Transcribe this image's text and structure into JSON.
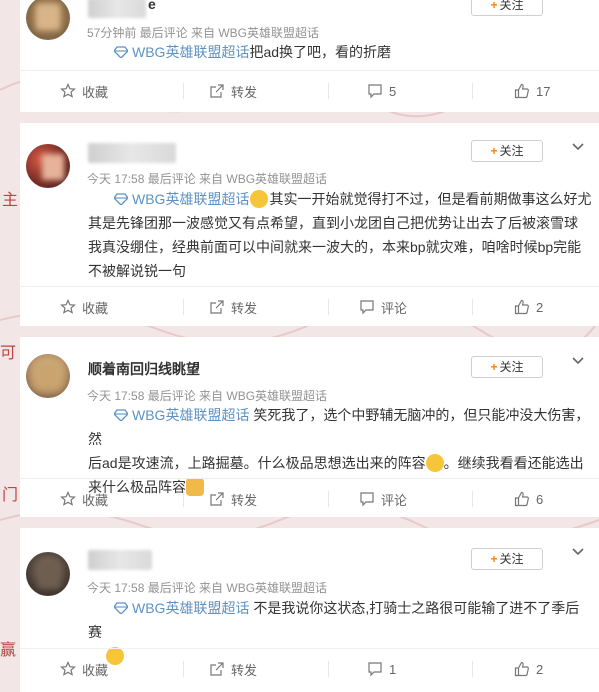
{
  "colors": {
    "topic": "#5e92c2",
    "follow_plus": "#ff8200",
    "meta": "#939393",
    "background": "#f3e6e6"
  },
  "posts": [
    {
      "name": "e",
      "meta": "57分钟前  最后评论  来自 WBG英雄联盟超话",
      "follow": "关注",
      "topic": "WBG英雄联盟超话",
      "text": "把ad换了吧，看的折磨",
      "actions": {
        "fav": "收藏",
        "fwd": "转发",
        "cmt": "5",
        "like": "17"
      }
    },
    {
      "name": "",
      "meta": "今天 17:58  最后评论  来自 WBG英雄联盟超话",
      "follow": "关注",
      "topic": "WBG英雄联盟超话",
      "emoji": "laughing-emoji",
      "text_line1": "其实一开始就觉得打不过，但是看前期做事这么好尤",
      "text_line2": "其是先锋团那一波感觉又有点希望，直到小龙团自己把优势让出去了后被滚雪球",
      "text_line3": "我真没绷住，经典前面可以中间就来一波大的，本来bp就灾难，咱啥时候bp完能",
      "text_line4": "不被解说锐一句",
      "actions": {
        "fav": "收藏",
        "fwd": "转发",
        "cmt": "评论",
        "like": "2"
      }
    },
    {
      "name": "顺着南回归线眺望",
      "meta": "今天 17:58  最后评论  来自 WBG英雄联盟超话",
      "follow": "关注",
      "topic": "WBG英雄联盟超话",
      "text_line1": " 笑死我了，选个中野辅无脑冲的，但只能冲没大伤害，然",
      "text_line2a": "后ad是攻速流，上路掘墓。什么极品思想选出来的阵容",
      "text_line2b": "。继续我看看还能选出",
      "text_line3": "来什么极品阵容",
      "emoji1": "grin-emoji",
      "emoji2": "thumbs-up-emoji",
      "actions": {
        "fav": "收藏",
        "fwd": "转发",
        "cmt": "评论",
        "like": "6"
      }
    },
    {
      "name": "",
      "meta": "今天 17:58  最后评论  来自 WBG英雄联盟超话",
      "follow": "关注",
      "topic": "WBG英雄联盟超话",
      "text": " 不是我说你这状态,打骑士之路很可能输了进不了季后赛",
      "emoji": "shushing-face-emoji",
      "actions": {
        "fav": "收藏",
        "fwd": "转发",
        "cmt": "1",
        "like": "2"
      }
    }
  ]
}
